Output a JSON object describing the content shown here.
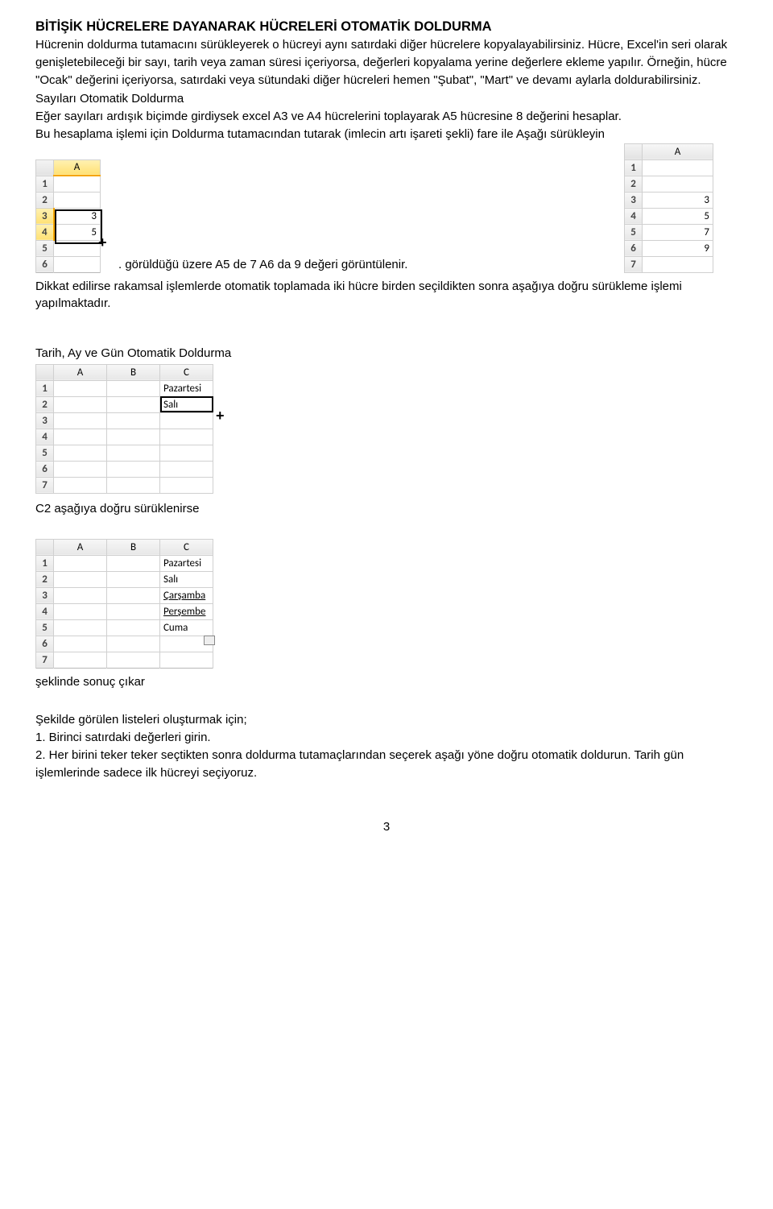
{
  "title": "BİTİŞİK HÜCRELERE DAYANARAK HÜCRELERİ OTOMATİK DOLDURMA",
  "p1": "Hücrenin doldurma tutamacını sürükleyerek o hücreyi aynı satırdaki diğer hücrelere kopyalayabilirsiniz. Hücre, Excel'in seri olarak genişletebileceği bir sayı, tarih veya zaman süresi içeriyorsa, değerleri kopyalama yerine değerlere ekleme yapılır. Örneğin, hücre \"Ocak\" değerini içeriyorsa, satırdaki veya sütundaki diğer hücreleri hemen \"Şubat\", \"Mart\" ve devamı aylarla doldurabilirsiniz.",
  "s1": "Sayıları Otomatik Doldurma",
  "p2": "Eğer sayıları ardışık biçimde girdiysek excel A3 ve A4 hücrelerini toplayarak A5 hücresine 8 değerini hesaplar.",
  "p3": "Bu hesaplama işlemi için  Doldurma tutamacından tutarak (imlecin artı işareti şekli) fare ile Aşağı sürükleyin",
  "after_images": ".            görüldüğü üzere A5 de 7 A6 da 9 değeri görüntülenir.",
  "p4": "Dikkat edilirse rakamsal işlemlerde otomatik toplamada iki hücre birden seçildikten sonra aşağıya doğru sürükleme işlemi yapılmaktadır.",
  "s2": "Tarih, Ay ve Gün Otomatik Doldurma",
  "p5": "C2 aşağıya doğru sürüklenirse",
  "p6": "şeklinde sonuç çıkar",
  "p7": "Şekilde görülen listeleri oluşturmak için;",
  "li1": "1. Birinci satırdaki değerleri girin.",
  "li2": "2. Her birini teker teker seçtikten sonra doldurma tutamaçlarından seçerek aşağı yöne doğru otomatik doldurun. Tarih gün işlemlerinde sadece ilk hücreyi seçiyoruz.",
  "page_num": "3",
  "xl1": {
    "col": "A",
    "rows": [
      "1",
      "2",
      "3",
      "4",
      "5",
      "6"
    ],
    "vals": {
      "3": "3",
      "4": "5"
    },
    "plus": "+"
  },
  "xl2": {
    "col": "A",
    "rows": [
      "1",
      "2",
      "3",
      "4",
      "5",
      "6",
      "7"
    ],
    "vals": {
      "3": "3",
      "4": "5",
      "5": "7",
      "6": "9"
    }
  },
  "xl3": {
    "cols": [
      "A",
      "B",
      "C"
    ],
    "rows": [
      "1",
      "2",
      "3",
      "4",
      "5",
      "6",
      "7"
    ],
    "vals": {
      "C1": "Pazartesi",
      "C2": "Salı"
    },
    "plus": "+"
  },
  "xl4": {
    "cols": [
      "A",
      "B",
      "C"
    ],
    "rows": [
      "1",
      "2",
      "3",
      "4",
      "5",
      "6",
      "7"
    ],
    "vals": {
      "C1": "Pazartesi",
      "C2": "Salı",
      "C3": "Çarşamba",
      "C4": "Perşembe",
      "C5": "Cuma"
    }
  }
}
